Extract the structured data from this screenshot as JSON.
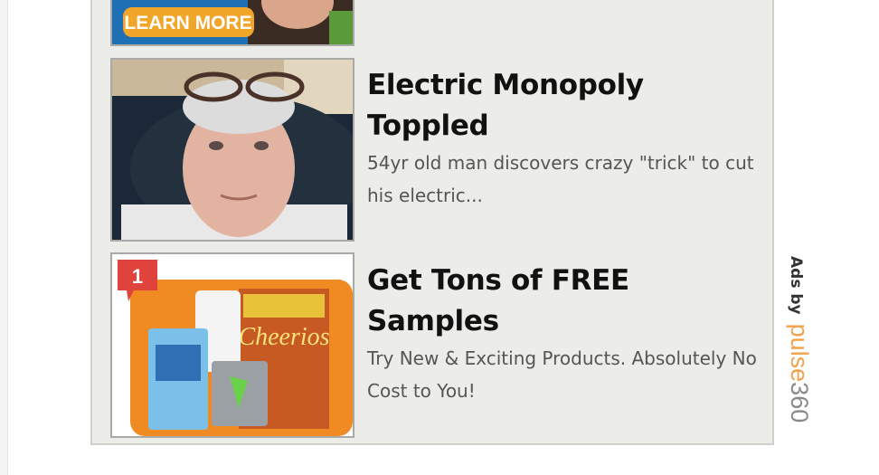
{
  "ads": [
    {
      "cta_label": "LEARN MORE"
    },
    {
      "title": "Electric Monopoly Toppled",
      "description": "54yr old man discovers crazy \"trick\" to cut his electric..."
    },
    {
      "title": "Get Tons of FREE Samples",
      "description": "Try New & Exciting Products. Absolutely No Cost to You!",
      "badge_count": "1"
    }
  ],
  "attribution": {
    "prefix": "Ads by",
    "brand_orange": "pulse",
    "brand_gray": "360"
  },
  "colors": {
    "panel_bg": "#ecede8",
    "brand_orange": "#f0a14a",
    "learn_more_button": "#f2a629",
    "badge_red": "#e0433b"
  }
}
